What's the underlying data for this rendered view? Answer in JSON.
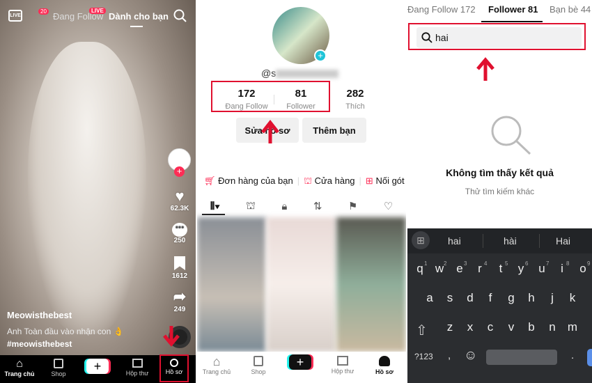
{
  "feed": {
    "live_label": "LIVE",
    "inbox_badge": "20",
    "tabs": [
      {
        "label": "Đang Follow",
        "badge": "LIVE"
      },
      {
        "label": "Dành cho bạn",
        "active": true
      }
    ],
    "rail": {
      "likes": "62.3K",
      "comments": "250",
      "saves": "1612",
      "shares": "249"
    },
    "caption": {
      "author": "Meowisthebest",
      "text": "Anh Toàn đầu vào nhận con",
      "emoji": "👌",
      "hashtag": "#meowisthebest"
    },
    "nav": [
      {
        "label": "Trang chủ",
        "icon": "home-icon"
      },
      {
        "label": "Shop",
        "icon": "shop-icon"
      },
      {
        "label": "",
        "icon": "create-plus-icon"
      },
      {
        "label": "Hộp thư",
        "icon": "inbox-icon"
      },
      {
        "label": "Hồ sơ",
        "icon": "profile-icon",
        "highlighted": true
      }
    ]
  },
  "profile": {
    "username_visible": "@s",
    "stats": [
      {
        "value": "172",
        "label": "Đang Follow"
      },
      {
        "value": "81",
        "label": "Follower"
      },
      {
        "value": "282",
        "label": "Thích"
      }
    ],
    "buttons": {
      "edit": "Sửa hồ sơ",
      "add_friend": "Thêm bạn"
    },
    "links": [
      {
        "label": "Đơn hàng của bạn",
        "icon": "cart-icon"
      },
      {
        "label": "Cửa hàng",
        "icon": "store-icon"
      },
      {
        "label": "Nối gót",
        "icon": "add-video-icon"
      }
    ],
    "nav": [
      {
        "label": "Trang chủ"
      },
      {
        "label": "Shop"
      },
      {
        "label": ""
      },
      {
        "label": "Hộp thư"
      },
      {
        "label": "Hồ sơ",
        "active": true
      }
    ]
  },
  "search": {
    "tabs": [
      {
        "label": "Đang Follow 172"
      },
      {
        "label": "Follower 81",
        "active": true
      },
      {
        "label": "Bạn bè 44"
      }
    ],
    "query": "hai",
    "empty_title": "Không tìm thấy kết quả",
    "empty_sub": "Thử tìm kiếm khác",
    "suggestions": [
      "hai",
      "hài",
      "Hai"
    ],
    "keyboard": {
      "row1": [
        "q",
        "w",
        "e",
        "r",
        "t",
        "y",
        "u",
        "i",
        "o"
      ],
      "row1_nums": [
        "1",
        "2",
        "3",
        "4",
        "5",
        "6",
        "7",
        "8",
        "9"
      ],
      "row2": [
        "a",
        "s",
        "d",
        "f",
        "g",
        "h",
        "j",
        "k"
      ],
      "row3": [
        "z",
        "x",
        "c",
        "v",
        "b",
        "n",
        "m"
      ],
      "symbols": "?123",
      "comma": ",",
      "period": "."
    }
  },
  "colors": {
    "accent_red": "#e0102f",
    "tiktok_pink": "#fe2c55",
    "tiktok_cyan": "#25f4ee",
    "keyboard_bg": "#2b2d30"
  }
}
